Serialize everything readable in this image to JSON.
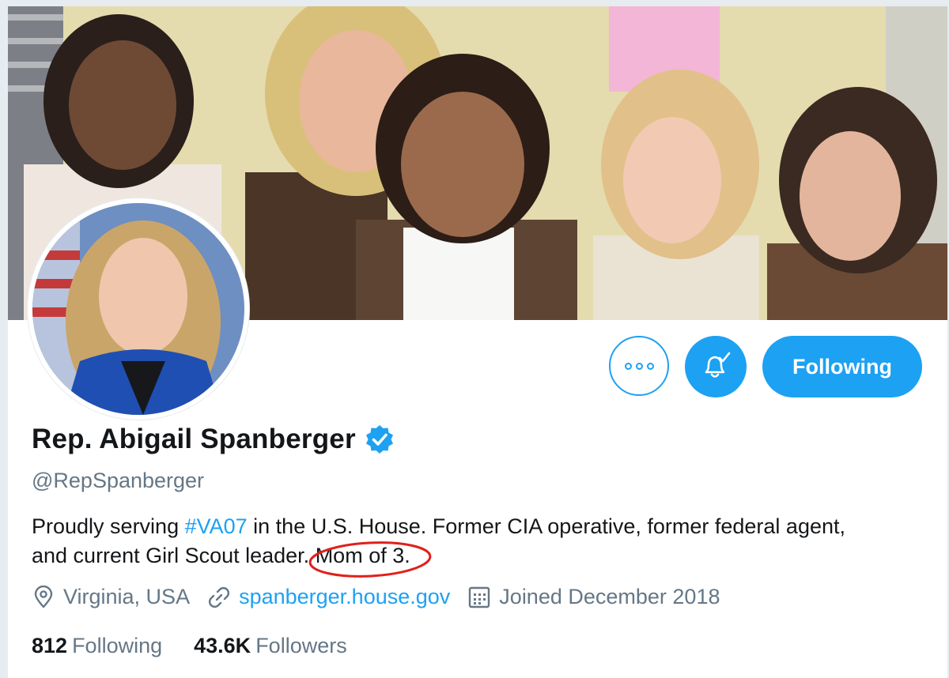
{
  "profile": {
    "name": "Rep. Abigail Spanberger",
    "handle": "@RepSpanberger",
    "bio": {
      "prefix": "Proudly serving ",
      "hashtag": "#VA07",
      "line1_rest": " in the U.S. House. Former CIA operative, former federal agent,",
      "line2_start": "and current Girl Scout leader. ",
      "highlight": "Mom of 3."
    },
    "location": "Virginia, USA",
    "website": "spanberger.house.gov",
    "joined": "Joined December 2018"
  },
  "actions": {
    "following_label": "Following"
  },
  "stats": {
    "following_count": "812",
    "following_label": "Following",
    "followers_count": "43.6K",
    "followers_label": "Followers"
  },
  "icons": {
    "verified": "verified-badge-icon",
    "more": "more-options-icon",
    "bell": "notification-bell-icon",
    "location": "location-pin-icon",
    "link": "link-icon",
    "calendar": "calendar-icon"
  },
  "colors": {
    "accent": "#1da1f2",
    "text": "#14171a",
    "muted": "#657786",
    "annotation": "#e0201b"
  }
}
